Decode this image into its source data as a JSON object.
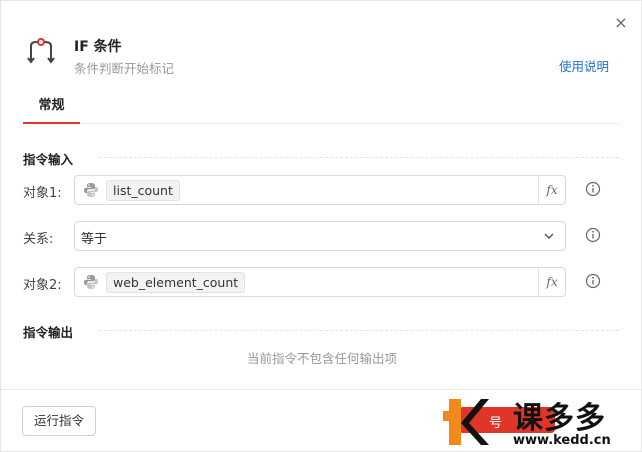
{
  "dialog": {
    "title": "IF 条件",
    "subtitle": "条件判断开始标记",
    "help_label": "使用说明",
    "close_label": "×"
  },
  "tabs": [
    {
      "label": "常规",
      "active": true
    }
  ],
  "input_section": {
    "title": "指令输入",
    "rows": [
      {
        "label": "对象1:",
        "value": "list_count",
        "type": "expression"
      },
      {
        "label": "关系:",
        "value": "等于",
        "type": "select"
      },
      {
        "label": "对象2:",
        "value": "web_element_count",
        "type": "expression"
      }
    ],
    "fx_label": "fx"
  },
  "output_section": {
    "title": "指令输出",
    "empty_text": "当前指令不包含任何输出项"
  },
  "footer": {
    "run_label": "运行指令"
  },
  "watermark": {
    "brand": "课多多",
    "url": "www.kedd.cn",
    "overlay_text": "号"
  },
  "colors": {
    "accent": "#e0362a",
    "link": "#1e6fd9"
  }
}
